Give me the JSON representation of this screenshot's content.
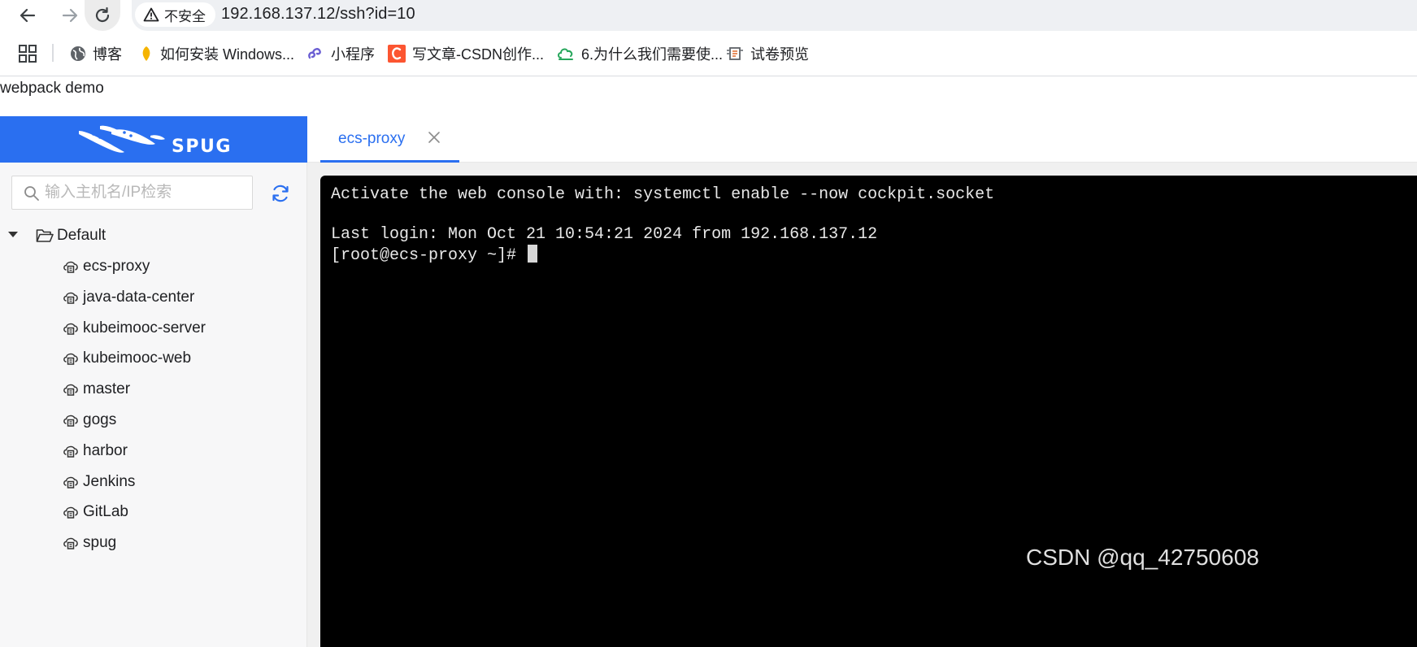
{
  "browser": {
    "security_label": "不安全",
    "url": "192.168.137.12/ssh?id=10",
    "bookmarks": [
      {
        "label": "博客",
        "icon": "globe-icon"
      },
      {
        "label": "如何安装 Windows...",
        "icon": "lightbulb-icon"
      },
      {
        "label": "小程序",
        "icon": "miniprogram-icon"
      },
      {
        "label": "写文章-CSDN创作...",
        "icon": "csdn-icon"
      },
      {
        "label": "6.为什么我们需要使...",
        "icon": "cloud-icon"
      },
      {
        "label": "试卷预览",
        "icon": "exam-icon"
      }
    ]
  },
  "page": {
    "title": "webpack demo"
  },
  "sidebar": {
    "logo_text": "SPUG",
    "search_placeholder": "输入主机名/IP检索",
    "root_group": "Default",
    "hosts": [
      "ecs-proxy",
      "java-data-center",
      "kubeimooc-server",
      "kubeimooc-web",
      "master",
      "gogs",
      "harbor",
      "Jenkins",
      "GitLab",
      "spug"
    ]
  },
  "tabs": [
    {
      "label": "ecs-proxy",
      "active": true
    }
  ],
  "terminal": {
    "lines": [
      "Activate the web console with: systemctl enable --now cockpit.socket",
      "",
      "Last login: Mon Oct 21 10:54:21 2024 from 192.168.137.12"
    ],
    "prompt": "[root@ecs-proxy ~]# "
  },
  "watermark": "CSDN @qq_42750608",
  "colors": {
    "accent": "#2a6ff0",
    "terminal_bg": "#000000",
    "terminal_fg": "#e8e8e8"
  }
}
